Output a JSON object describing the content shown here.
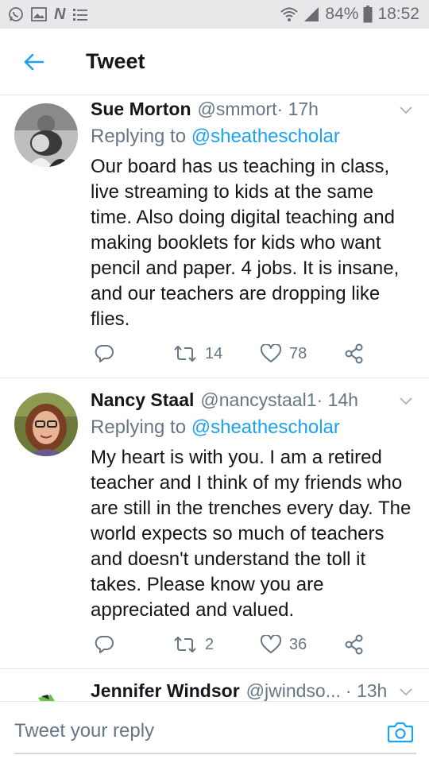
{
  "status_bar": {
    "battery": "84%",
    "time": "18:52",
    "icons": [
      "whatsapp-icon",
      "gallery-icon",
      "n-app-icon",
      "checklist-icon",
      "wifi-icon",
      "signal-icon",
      "battery-icon"
    ]
  },
  "header": {
    "title": "Tweet",
    "back_icon": "arrow-left-icon",
    "accent": "#1da1f2"
  },
  "tweets": [
    {
      "name": "Sue Morton",
      "handle": "@smmort",
      "time": " · 17h",
      "replying_prefix": "Replying to ",
      "replying_to": "@sheathescholar",
      "text": "Our board has us teaching in class, live streaming to kids at the same time. Also doing digital teaching and making booklets for kids who want pencil and paper. 4 jobs. It is insane, and our teachers are dropping like flies.",
      "retweets": "14",
      "likes": "78"
    },
    {
      "name": "Nancy Staal",
      "handle": "@nancystaal1",
      "time": " · 14h",
      "replying_prefix": "Replying to ",
      "replying_to": "@sheathescholar",
      "text": "My heart is with you. I am a retired teacher and I think of my friends who are still in the trenches every day. The world expects so much of teachers and doesn't understand the toll it takes. Please know you are appreciated and valued.",
      "retweets": "2",
      "likes": "36"
    },
    {
      "name": "Jennifer Windsor",
      "handle": "@jwindso...",
      "time": " · 13h"
    }
  ],
  "reply_bar": {
    "placeholder": "Tweet your reply",
    "camera_icon": "camera-icon"
  },
  "colors": {
    "link": "#1da1f2",
    "secondary_text": "#657786",
    "divider": "#e1e8ed"
  }
}
